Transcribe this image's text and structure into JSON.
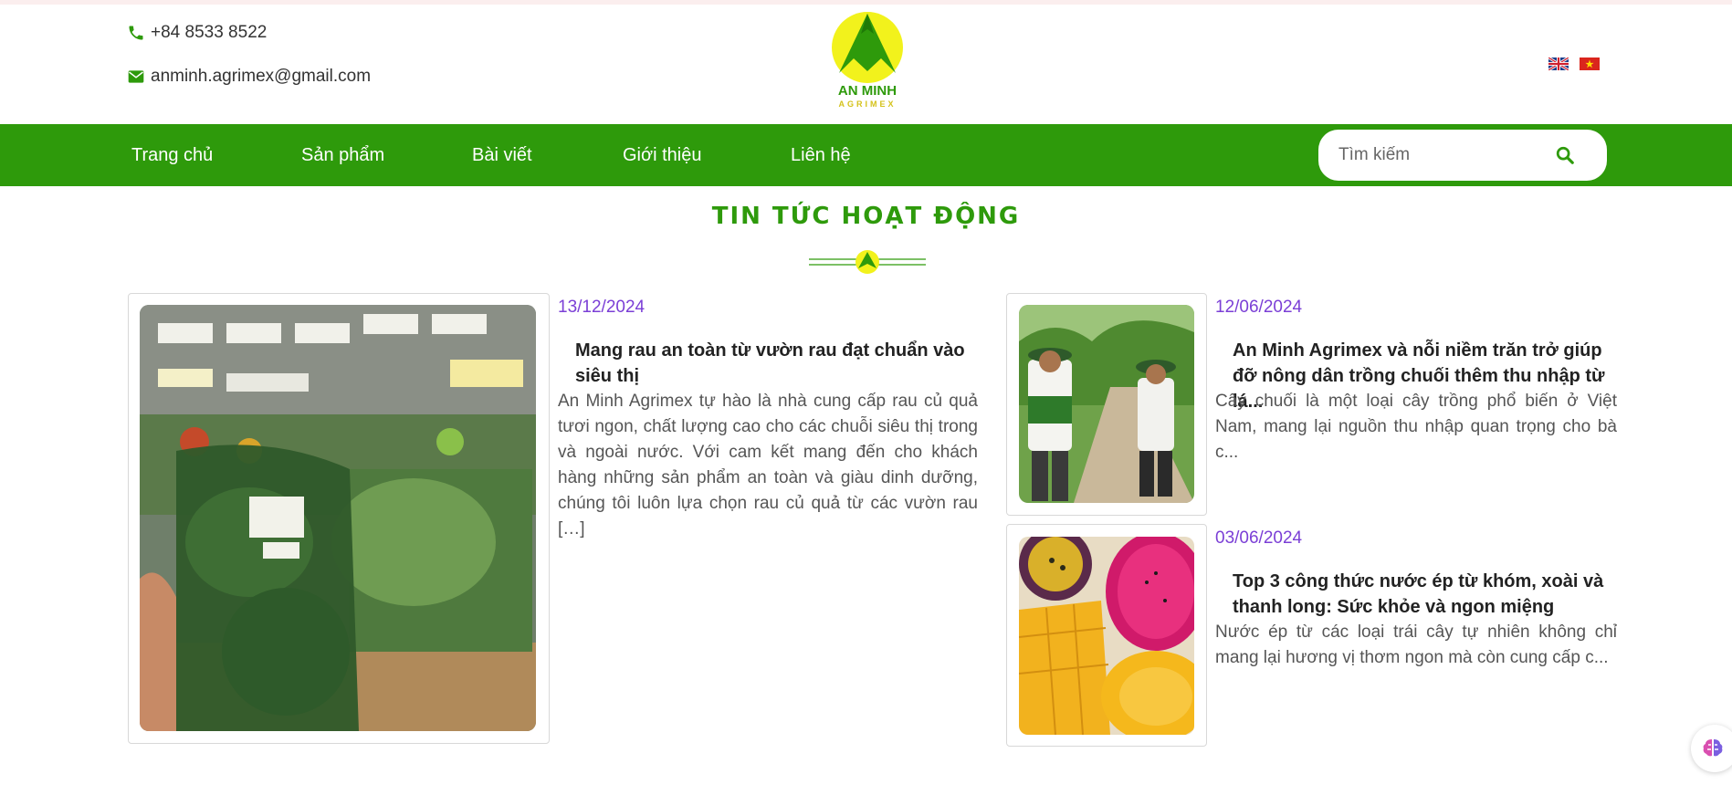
{
  "header": {
    "phone": "+84 8533 8522",
    "email": "anminh.agrimex@gmail.com",
    "logo_text": "AN MINH",
    "logo_subtext": "AGRIMEX"
  },
  "nav": {
    "items": [
      "Trang chủ",
      "Sản phẩm",
      "Bài viết",
      "Giới thiệu",
      "Liên hệ"
    ]
  },
  "search": {
    "placeholder": "Tìm kiếm"
  },
  "section": {
    "title": "TIN TỨC HOẠT ĐỘNG"
  },
  "posts": [
    {
      "date": "13/12/2024",
      "title": "Mang rau an toàn từ vườn rau đạt chuẩn vào siêu thị",
      "excerpt": "An Minh Agrimex tự hào là nhà cung cấp rau củ quả tươi ngon, chất lượng cao cho các chuỗi siêu thị trong và ngoài nước. Với cam kết mang đến cho khách hàng những sản phẩm an toàn và giàu dinh dưỡng, chúng tôi luôn lựa chọn rau củ quả từ các vườn rau […]"
    },
    {
      "date": "12/06/2024",
      "title": "An Minh Agrimex và nỗi niềm trăn trở giúp đỡ nông dân trồng chuối thêm thu nhập từ lá...",
      "excerpt": "Cây chuối là một loại cây trồng phổ biến ở Việt Nam, mang lại nguồn thu nhập quan trọng cho bà c..."
    },
    {
      "date": "03/06/2024",
      "title": "Top 3 công thức nước ép từ khóm, xoài và thanh long: Sức khỏe và ngon miệng",
      "excerpt": "Nước ép từ các loại trái cây tự nhiên không chỉ mang lại hương vị thơm ngon mà còn cung cấp c..."
    }
  ],
  "colors": {
    "brand_green": "#2e9a0b",
    "date_purple": "#7b3fd6",
    "logo_yellow": "#f2f21c"
  }
}
